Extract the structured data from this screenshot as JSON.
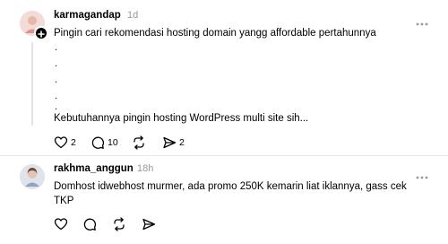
{
  "posts": [
    {
      "username": "karmagandap",
      "time": "1d",
      "lines": [
        "Pingin cari rekomendasi hosting domain yangg affordable pertahunnya",
        ".",
        ".",
        ".",
        ".",
        ".",
        "Kebutuhannya pingin hosting WordPress multi site sih..."
      ],
      "counts": {
        "likes": "2",
        "replies": "10",
        "shares": "2"
      },
      "icons": {
        "avatar": "avatar-person-icon",
        "badge": "follow-plus-icon",
        "more": "more-horizontal-icon"
      }
    },
    {
      "username": "rakhma_anggun",
      "time": "18h",
      "text": "Domhost idwebhost murmer, ada promo 250K kemarin liat iklannya, gass cek TKP",
      "icons": {
        "avatar": "avatar-person-icon",
        "more": "more-horizontal-icon"
      }
    }
  ],
  "action_icons": [
    "heart-icon",
    "comment-icon",
    "repost-icon",
    "share-icon"
  ],
  "colors": {
    "text": "#000000",
    "muted": "#999999",
    "divider": "#e6e6e6",
    "thread_line": "#e2e2e2"
  }
}
